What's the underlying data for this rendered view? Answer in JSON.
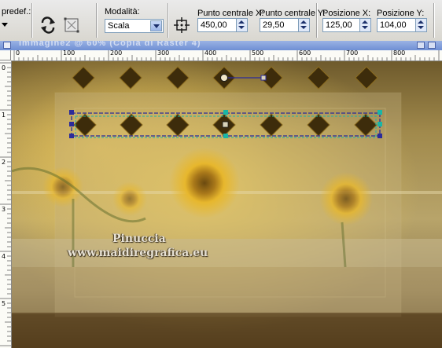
{
  "toolbar": {
    "preset_label": "predef.:",
    "mode_label": "Modalità:",
    "mode_value": "Scala",
    "center_x_label": "Punto centrale X:",
    "center_x_value": "450,00",
    "center_y_label": "Punto centrale Y:",
    "center_y_value": "29,50",
    "pos_x_label": "Posizione X:",
    "pos_x_value": "125,00",
    "pos_y_label": "Posizione Y:",
    "pos_y_value": "104,00"
  },
  "ruler": {
    "top_ticks": [
      "0",
      "100",
      "200",
      "300",
      "400",
      "500",
      "600",
      "700",
      "800"
    ],
    "left_ticks": [
      "0",
      "1",
      "2",
      "3",
      "4",
      "5"
    ]
  },
  "canvas": {
    "watermark_line1": "Pinuccia",
    "watermark_line2": "www.maidiregrafica.eu",
    "colors": {
      "diamond": "#3d2c0b",
      "diamond_border": "#8a6a1e",
      "selection": "#2b2b9a",
      "handle_teal": "#18b6a6"
    }
  },
  "icons": {
    "preset": "preset-dropdown-icon",
    "rotate": "rotate-arrows-icon",
    "transform": "free-transform-icon",
    "center": "center-target-icon"
  }
}
